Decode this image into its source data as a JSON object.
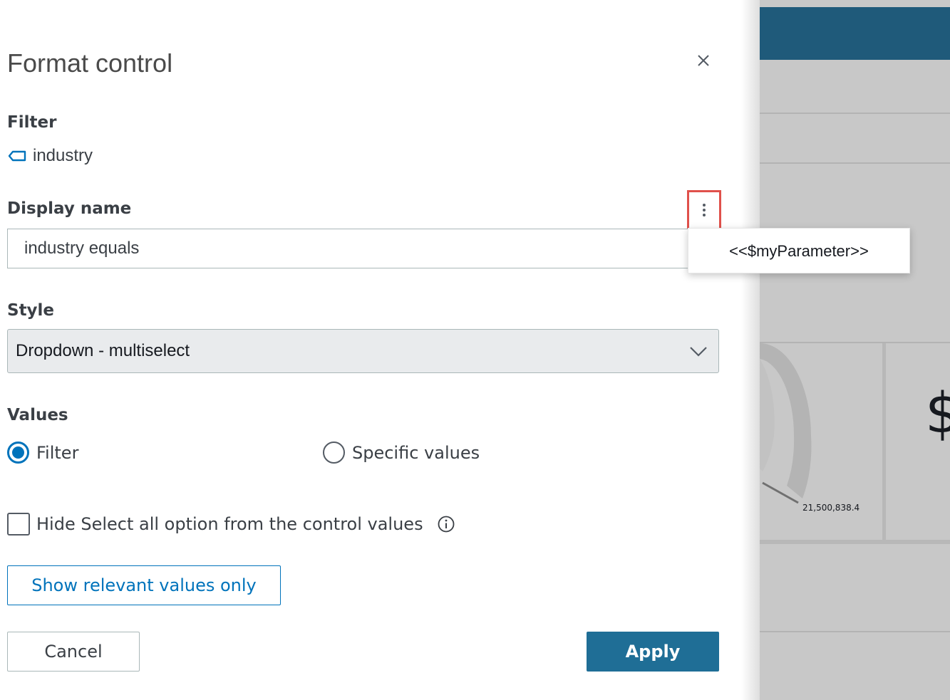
{
  "panel": {
    "title": "Format control",
    "close_icon": "close-icon"
  },
  "filter": {
    "label": "Filter",
    "field_name": "industry",
    "field_icon": "dimension-tag-icon"
  },
  "display_name": {
    "label": "Display name",
    "value": "industry equals",
    "menu_icon": "kebab-menu-icon",
    "menu_items": [
      "<<$myParameter>>"
    ]
  },
  "style": {
    "label": "Style",
    "selected": "Dropdown - multiselect",
    "chevron_icon": "chevron-down-icon"
  },
  "values": {
    "label": "Values",
    "options": [
      {
        "label": "Filter",
        "selected": true
      },
      {
        "label": "Specific values",
        "selected": false
      }
    ]
  },
  "hide_select_all": {
    "label": "Hide Select all option from the control values",
    "checked": false,
    "info_icon": "info-icon"
  },
  "buttons": {
    "relevant": "Show relevant values only",
    "cancel": "Cancel",
    "apply": "Apply"
  },
  "background": {
    "gauge_value": "21,500,838.4",
    "kpi_partial": "$"
  },
  "colors": {
    "accent": "#0073bb",
    "apply_bg": "#1f6e96",
    "header_bg": "#1f5a7a",
    "highlight": "#e0514b"
  }
}
